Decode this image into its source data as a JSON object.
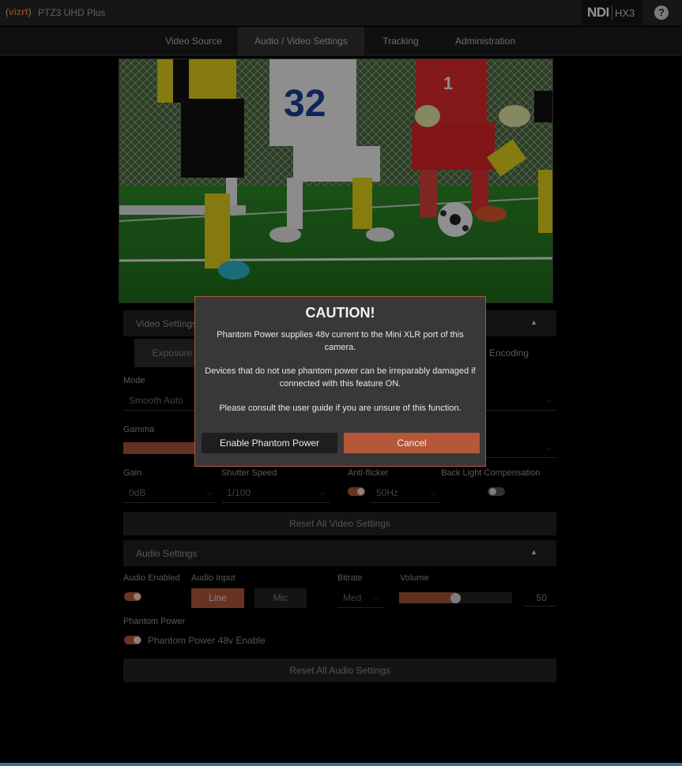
{
  "header": {
    "logo": "vizrt",
    "product_name": "PTZ3 UHD Plus",
    "ndi_label": "NDI",
    "hx_label": "HX3",
    "help_glyph": "?"
  },
  "nav": {
    "tabs": [
      {
        "label": "Video Source"
      },
      {
        "label": "Audio / Video Settings"
      },
      {
        "label": "Tracking"
      },
      {
        "label": "Administration"
      }
    ],
    "active_index": 1
  },
  "video_settings": {
    "title": "Video Settings",
    "subtabs": [
      {
        "label": "Exposure"
      },
      {
        "label": "Encoding"
      }
    ],
    "mode_label": "Mode",
    "mode_value": "Smooth Auto",
    "gamma_label": "Gamma",
    "gain_label": "Gain",
    "gain_value": "0dB",
    "shutter_label": "Shutter Speed",
    "shutter_value": "1/100",
    "antiflicker_label": "Anti-flicker",
    "antiflicker_value": "50Hz",
    "antiflicker_on": true,
    "blc_label": "Back Light Compensation",
    "blc_on": false,
    "reset_label": "Reset All Video Settings"
  },
  "audio_settings": {
    "title": "Audio Settings",
    "enabled_label": "Audio Enabled",
    "enabled_on": true,
    "input_label": "Audio Input",
    "input_options": [
      "Line",
      "Mic"
    ],
    "input_selected": "Line",
    "bitrate_label": "Bitrate",
    "bitrate_value": "Med",
    "volume_label": "Volume",
    "volume_value": "50",
    "phantom_label": "Phantom Power",
    "phantom_toggle_label": "Phantom Power 48v Enable",
    "phantom_on": true,
    "reset_label": "Reset All Audio Settings"
  },
  "modal": {
    "title": "CAUTION!",
    "line1": "Phantom Power supplies 48v current to the Mini XLR port of this camera.",
    "line2": "Devices that do not use phantom power can be irreparably damaged if connected with this feature ON.",
    "line3": "Please consult the user guide if you are unsure of this function.",
    "enable_label": "Enable Phantom Power",
    "cancel_label": "Cancel"
  },
  "preview": {
    "jersey_numbers": [
      "32",
      "1"
    ]
  },
  "colors": {
    "accent": "#b5583a",
    "background": "#000000",
    "panel": "#1f1f1f"
  }
}
